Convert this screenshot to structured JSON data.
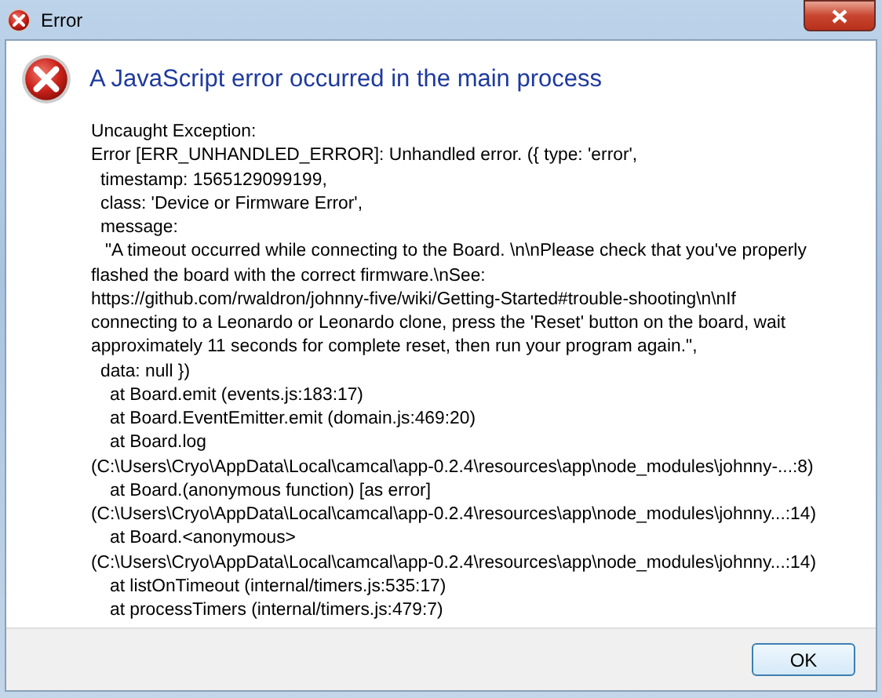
{
  "window": {
    "title": "Error"
  },
  "heading": "A JavaScript error occurred in the main process",
  "lines": [
    {
      "kind": "top",
      "text": "Uncaught Exception:"
    },
    {
      "kind": "top",
      "text": "Error [ERR_UNHANDLED_ERROR]: Unhandled error. ({ type: 'error',"
    },
    {
      "kind": "field",
      "text": "timestamp: 1565129099199,"
    },
    {
      "kind": "field",
      "text": "class: 'Device or Firmware Error',"
    },
    {
      "kind": "field",
      "text": "message:"
    },
    {
      "kind": "quote",
      "text": "\"A timeout occurred while connecting to the Board. \\n\\nPlease check that you've properly"
    },
    {
      "kind": "top",
      "text": "flashed the board with the correct firmware.\\nSee:"
    },
    {
      "kind": "top",
      "text": "https://github.com/rwaldron/johnny-five/wiki/Getting-Started#trouble-shooting\\n\\nIf"
    },
    {
      "kind": "top",
      "text": "connecting to a Leonardo or Leonardo clone, press the 'Reset' button on the board, wait"
    },
    {
      "kind": "top",
      "text": "approximately 11 seconds for complete reset, then run your program again.\","
    },
    {
      "kind": "field",
      "text": "data: null })"
    },
    {
      "kind": "frame",
      "text": "at Board.emit (events.js:183:17)"
    },
    {
      "kind": "frame",
      "text": "at Board.EventEmitter.emit (domain.js:469:20)"
    },
    {
      "kind": "frame",
      "text": "at Board.log"
    },
    {
      "kind": "top",
      "text": "(C:\\Users\\Cryo\\AppData\\Local\\camcal\\app-0.2.4\\resources\\app\\node_modules\\johnny-...:8)"
    },
    {
      "kind": "frame",
      "text": "at Board.(anonymous function) [as error]"
    },
    {
      "kind": "top",
      "text": "(C:\\Users\\Cryo\\AppData\\Local\\camcal\\app-0.2.4\\resources\\app\\node_modules\\johnny...:14)"
    },
    {
      "kind": "frame",
      "text": "at Board.<anonymous>"
    },
    {
      "kind": "top",
      "text": "(C:\\Users\\Cryo\\AppData\\Local\\camcal\\app-0.2.4\\resources\\app\\node_modules\\johnny...:14)"
    },
    {
      "kind": "frame",
      "text": "at listOnTimeout (internal/timers.js:535:17)"
    },
    {
      "kind": "frame",
      "text": "at processTimers (internal/timers.js:479:7)"
    }
  ],
  "buttons": [
    "OK"
  ]
}
